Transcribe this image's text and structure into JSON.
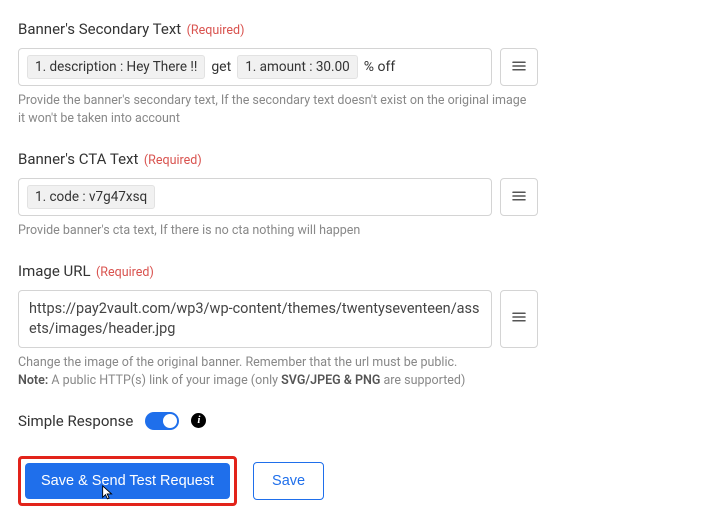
{
  "fields": {
    "secondary": {
      "label": "Banner's Secondary Text",
      "required_text": "(Required)",
      "token_desc": "1. description : Hey There !!",
      "mid_text": "get",
      "token_amount": "1. amount : 30.00",
      "tail_text": "% off",
      "help": "Provide the banner's secondary text, If the secondary text doesn't exist on the original image it won't be taken into account"
    },
    "cta": {
      "label": "Banner's CTA Text",
      "required_text": "(Required)",
      "token_code": "1. code : v7g47xsq",
      "help": "Provide banner's cta text, If there is no cta nothing will happen"
    },
    "image": {
      "label": "Image URL",
      "required_text": "(Required)",
      "value": "https://pay2vault.com/wp3/wp-content/themes/twentyseventeen/assets/images/header.jpg",
      "help_line1": "Change the image of the original banner. Remember that the url must be public.",
      "help_note_label": "Note:",
      "help_note_pre": " A public HTTP(s) link of your image (only ",
      "help_note_formats": "SVG/JPEG & PNG",
      "help_note_post": " are supported)"
    }
  },
  "simple": {
    "label": "Simple Response",
    "toggled": true,
    "info_char": "i"
  },
  "buttons": {
    "primary": "Save & Send Test Request",
    "secondary": "Save"
  }
}
